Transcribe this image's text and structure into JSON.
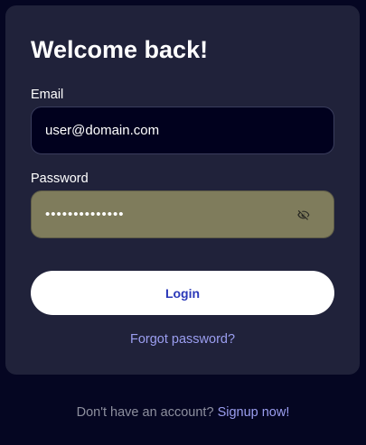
{
  "form": {
    "title": "Welcome back!",
    "email_label": "Email",
    "email_value": "user@domain.com",
    "password_label": "Password",
    "password_masked": "••••••••••••••",
    "toggle_visibility_icon": "eye-off-icon",
    "login_label": "Login",
    "forgot_label": "Forgot password?"
  },
  "footer": {
    "prompt": "Don't have an account?",
    "signup_label": "Signup now!"
  },
  "colors": {
    "background": "#050622",
    "card": "#20223a",
    "email_input_bg": "#01011e",
    "password_input_bg": "#7f7c5c",
    "button_bg": "#ffffff",
    "button_text": "#2a38b8",
    "link": "#9b9ef0"
  }
}
